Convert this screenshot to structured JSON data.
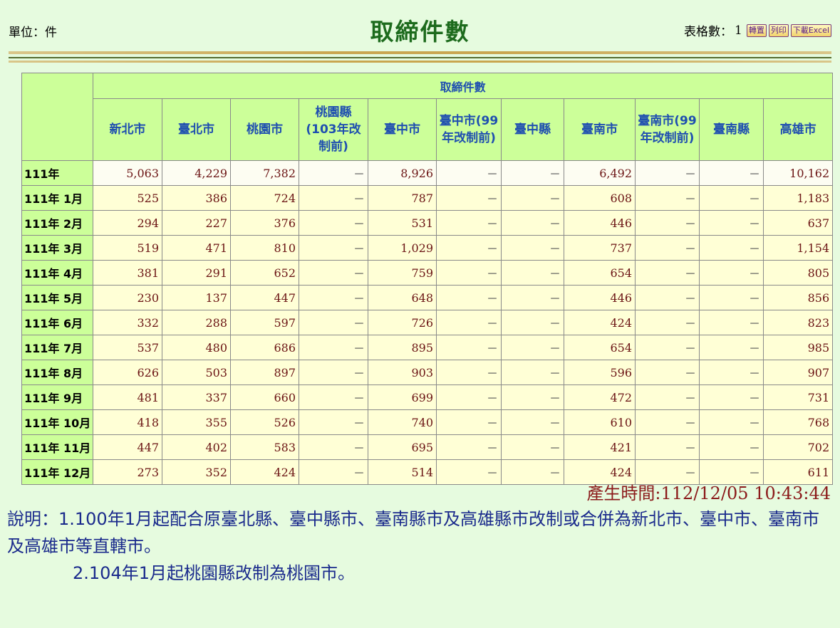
{
  "header": {
    "unit": "單位：件",
    "title": "取締件數",
    "table_count_label": "表格數：",
    "table_count": "1",
    "btn_transpose": "轉置",
    "btn_print": "列印",
    "btn_excel": "下載Excel"
  },
  "table": {
    "group_header": "取締件數",
    "columns": [
      "新北市",
      "臺北市",
      "桃園市",
      "桃園縣(103年改制前)",
      "臺中市",
      "臺中市(99年改制前)",
      "臺中縣",
      "臺南市",
      "臺南市(99年改制前)",
      "臺南縣",
      "高雄市"
    ],
    "rows": [
      {
        "label": "111年",
        "values": [
          "5,063",
          "4,229",
          "7,382",
          "－",
          "8,926",
          "－",
          "－",
          "6,492",
          "－",
          "－",
          "10,162"
        ]
      },
      {
        "label": "111年 1月",
        "values": [
          "525",
          "386",
          "724",
          "－",
          "787",
          "－",
          "－",
          "608",
          "－",
          "－",
          "1,183"
        ]
      },
      {
        "label": "111年 2月",
        "values": [
          "294",
          "227",
          "376",
          "－",
          "531",
          "－",
          "－",
          "446",
          "－",
          "－",
          "637"
        ]
      },
      {
        "label": "111年 3月",
        "values": [
          "519",
          "471",
          "810",
          "－",
          "1,029",
          "－",
          "－",
          "737",
          "－",
          "－",
          "1,154"
        ]
      },
      {
        "label": "111年 4月",
        "values": [
          "381",
          "291",
          "652",
          "－",
          "759",
          "－",
          "－",
          "654",
          "－",
          "－",
          "805"
        ]
      },
      {
        "label": "111年 5月",
        "values": [
          "230",
          "137",
          "447",
          "－",
          "648",
          "－",
          "－",
          "446",
          "－",
          "－",
          "856"
        ]
      },
      {
        "label": "111年 6月",
        "values": [
          "332",
          "288",
          "597",
          "－",
          "726",
          "－",
          "－",
          "424",
          "－",
          "－",
          "823"
        ]
      },
      {
        "label": "111年 7月",
        "values": [
          "537",
          "480",
          "686",
          "－",
          "895",
          "－",
          "－",
          "654",
          "－",
          "－",
          "985"
        ]
      },
      {
        "label": "111年 8月",
        "values": [
          "626",
          "503",
          "897",
          "－",
          "903",
          "－",
          "－",
          "596",
          "－",
          "－",
          "907"
        ]
      },
      {
        "label": "111年 9月",
        "values": [
          "481",
          "337",
          "660",
          "－",
          "699",
          "－",
          "－",
          "472",
          "－",
          "－",
          "731"
        ]
      },
      {
        "label": "111年 10月",
        "values": [
          "418",
          "355",
          "526",
          "－",
          "740",
          "－",
          "－",
          "610",
          "－",
          "－",
          "768"
        ]
      },
      {
        "label": "111年 11月",
        "values": [
          "447",
          "402",
          "583",
          "－",
          "695",
          "－",
          "－",
          "421",
          "－",
          "－",
          "702"
        ]
      },
      {
        "label": "111年 12月",
        "values": [
          "273",
          "352",
          "424",
          "－",
          "514",
          "－",
          "－",
          "424",
          "－",
          "－",
          "611"
        ]
      }
    ]
  },
  "footer": {
    "generated": "產生時間:112/12/05 10:43:44",
    "note_line1": "說明：1.100年1月起配合原臺北縣、臺中縣市、臺南縣市及高雄縣市改制或合併為新北市、臺中市、臺南市及高雄市等直轄市。",
    "note_line2": "2.104年1月起桃園縣改制為桃園市。"
  },
  "colors": {
    "background": "#e6fbdf",
    "header_cell": "#ccff99",
    "data_cell": "#ffffd6",
    "title": "#1d6b1d",
    "column_header_text": "#1f4fb0",
    "number_text": "#6b1414",
    "note_text": "#1a2a8c",
    "generated_text": "#8b1a1a"
  }
}
